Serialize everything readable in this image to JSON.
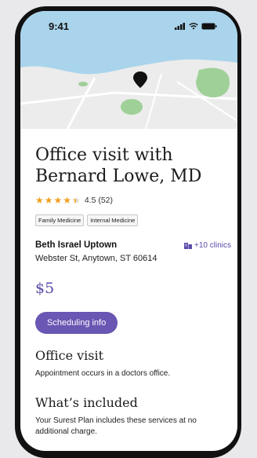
{
  "status_bar": {
    "time": "9:41"
  },
  "map": {
    "pin_icon": "map-pin-icon"
  },
  "provider": {
    "title": "Office visit with Bernard Lowe, MD",
    "rating_value": "4.5 (52)",
    "rating_stars": 4.5,
    "tags": [
      "Family Medicine",
      "Internal Medicine"
    ]
  },
  "clinic": {
    "name": "Beth Israel Uptown",
    "more_label": "+10 clinics",
    "address": "Webster St, Anytown, ST 60614"
  },
  "price": "$5",
  "scheduling_button": "Scheduling info",
  "office_visit": {
    "heading": "Office visit",
    "text": "Appointment occurs in a doctors office."
  },
  "included": {
    "heading": "What’s included",
    "text": "Your Surest Plan includes these services at no additional charge."
  },
  "colors": {
    "accent": "#6a56b3",
    "star": "#f0a020",
    "map_land": "#ececec",
    "map_water": "#a9d4ec",
    "map_park": "#9fd098"
  }
}
